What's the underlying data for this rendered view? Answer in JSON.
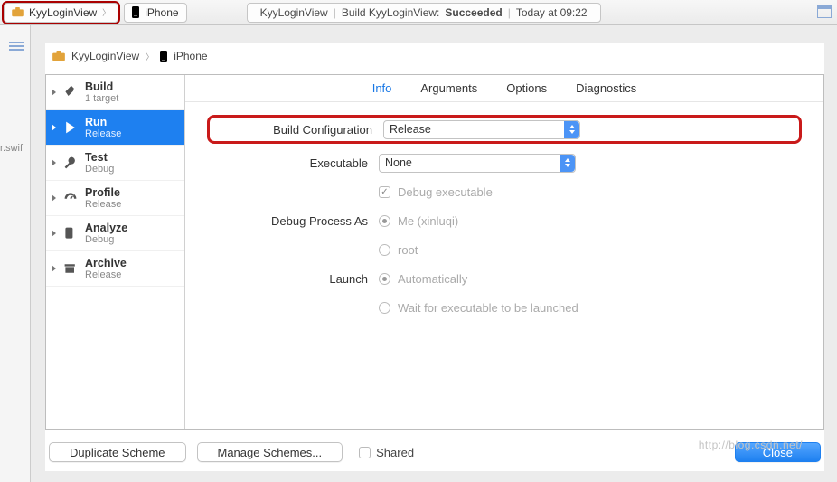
{
  "toolbar": {
    "scheme": "KyyLoginView",
    "device": "iPhone",
    "status_a": "KyyLoginView",
    "status_b_pre": "Build KyyLoginView:",
    "status_b_res": "Succeeded",
    "status_c": "Today at 09:22"
  },
  "leftStrip": {
    "file": "r.swif"
  },
  "crumb": {
    "project": "KyyLoginView",
    "device": "iPhone"
  },
  "side": {
    "items": [
      {
        "title": "Build",
        "sub": "1 target"
      },
      {
        "title": "Run",
        "sub": "Release"
      },
      {
        "title": "Test",
        "sub": "Debug"
      },
      {
        "title": "Profile",
        "sub": "Release"
      },
      {
        "title": "Analyze",
        "sub": "Debug"
      },
      {
        "title": "Archive",
        "sub": "Release"
      }
    ]
  },
  "tabs": {
    "info": "Info",
    "arguments": "Arguments",
    "options": "Options",
    "diagnostics": "Diagnostics"
  },
  "form": {
    "buildConfig_label": "Build Configuration",
    "buildConfig_value": "Release",
    "exec_label": "Executable",
    "exec_value": "None",
    "debugExec": "Debug executable",
    "debugProcAs_label": "Debug Process As",
    "me": "Me (xinluqi)",
    "root": "root",
    "launch_label": "Launch",
    "launch_auto": "Automatically",
    "launch_wait": "Wait for executable to be launched"
  },
  "footer": {
    "dup": "Duplicate Scheme",
    "manage": "Manage Schemes...",
    "shared": "Shared",
    "close": "Close"
  },
  "watermark": "http://blog.csdn.net/"
}
